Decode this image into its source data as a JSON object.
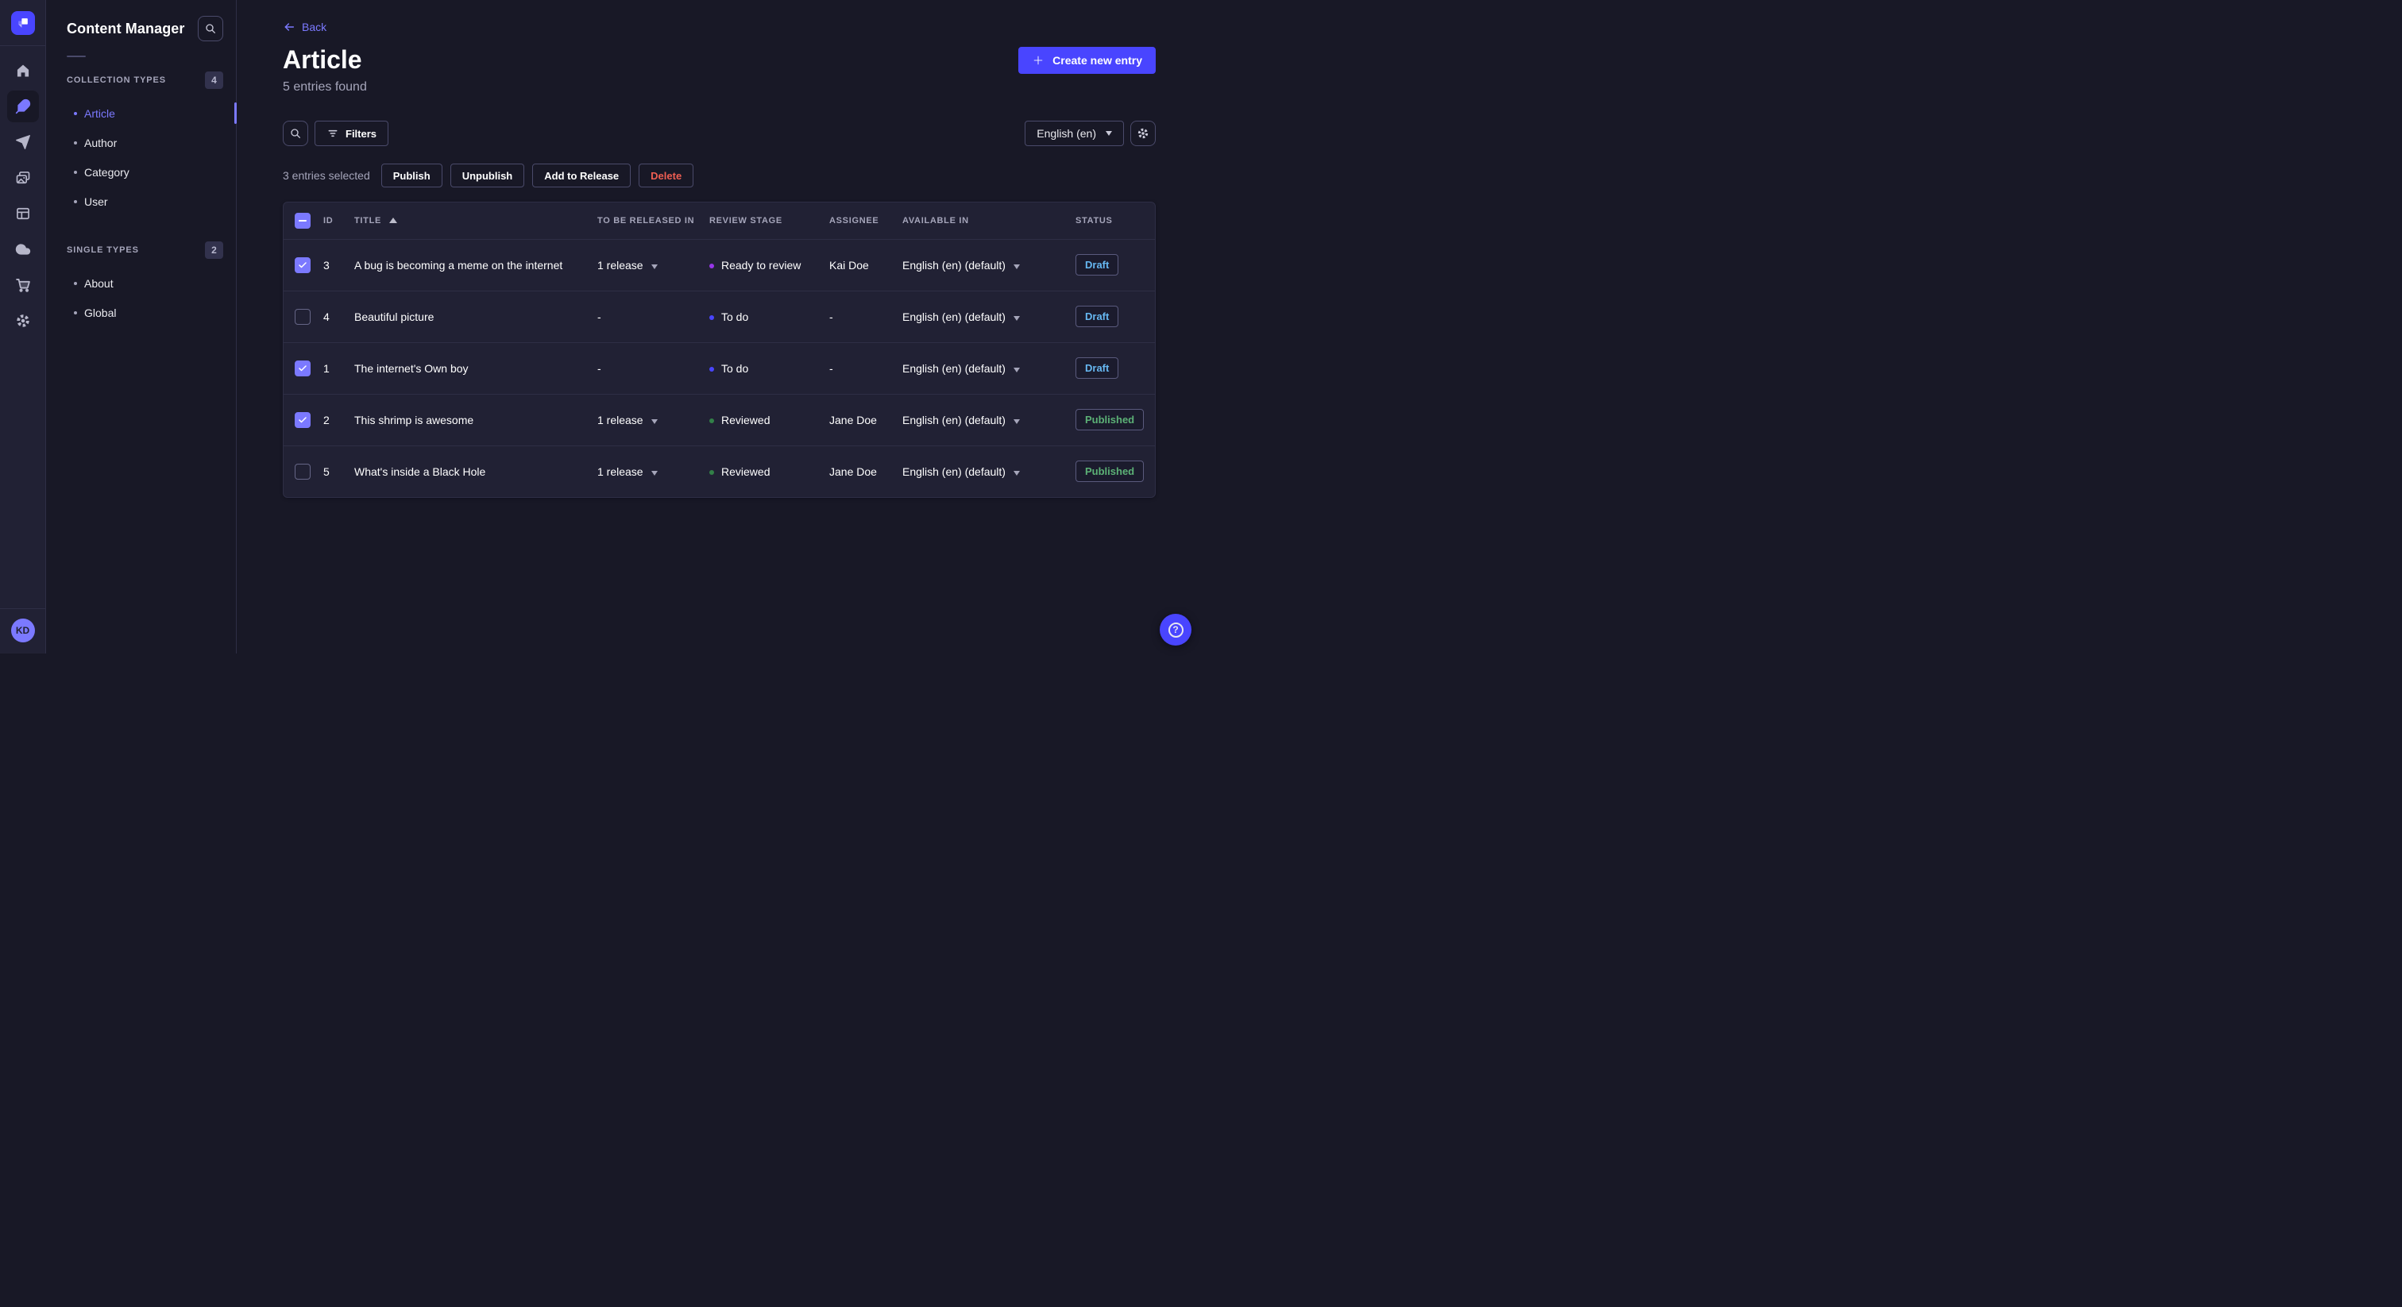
{
  "rail": {
    "logo_icon": "strapi-logo-icon",
    "items": [
      {
        "icon": "home-icon",
        "active": false
      },
      {
        "icon": "content-manager-feather-icon",
        "active": true
      },
      {
        "icon": "releases-paper-plane-icon",
        "active": false
      },
      {
        "icon": "media-library-images-icon",
        "active": false
      },
      {
        "icon": "content-type-builder-layout-icon",
        "active": false
      },
      {
        "icon": "deploy-cloud-icon",
        "active": false
      },
      {
        "icon": "marketplace-cart-icon",
        "active": false
      },
      {
        "icon": "settings-gear-icon",
        "active": false
      }
    ],
    "avatar_initials": "KD"
  },
  "subnav": {
    "title": "Content Manager",
    "search_icon": "search-icon",
    "sections": [
      {
        "label": "COLLECTION TYPES",
        "count": "4",
        "items": [
          {
            "label": "Article",
            "active": true
          },
          {
            "label": "Author",
            "active": false
          },
          {
            "label": "Category",
            "active": false
          },
          {
            "label": "User",
            "active": false
          }
        ]
      },
      {
        "label": "SINGLE TYPES",
        "count": "2",
        "items": [
          {
            "label": "About",
            "active": false
          },
          {
            "label": "Global",
            "active": false
          }
        ]
      }
    ]
  },
  "header": {
    "back_label": "Back",
    "title": "Article",
    "subtitle": "5 entries found",
    "create_button_label": "Create new entry"
  },
  "toolbar": {
    "filters_button_label": "Filters",
    "locale_selected": "English (en)"
  },
  "selection": {
    "summary": "3 entries selected",
    "publish_label": "Publish",
    "unpublish_label": "Unpublish",
    "add_to_release_label": "Add to Release",
    "delete_label": "Delete"
  },
  "table": {
    "header_checkbox_state": "indeterminate",
    "sort_column": "TITLE",
    "sort_direction": "asc",
    "columns": [
      "ID",
      "TITLE",
      "TO BE RELEASED IN",
      "REVIEW STAGE",
      "ASSIGNEE",
      "AVAILABLE IN",
      "STATUS"
    ],
    "rows": [
      {
        "checked": true,
        "id": "3",
        "title": "A bug is becoming a meme on the internet",
        "release": "1 release",
        "release_dropdown": true,
        "stage": "Ready to review",
        "stage_color": "#9736e8",
        "assignee": "Kai Doe",
        "available_in": "English (en) (default)",
        "status": "Draft"
      },
      {
        "checked": false,
        "id": "4",
        "title": "Beautiful picture",
        "release": "-",
        "release_dropdown": false,
        "stage": "To do",
        "stage_color": "#4945ff",
        "assignee": "-",
        "available_in": "English (en) (default)",
        "status": "Draft"
      },
      {
        "checked": true,
        "id": "1",
        "title": "The internet's Own boy",
        "release": "-",
        "release_dropdown": false,
        "stage": "To do",
        "stage_color": "#4945ff",
        "assignee": "-",
        "available_in": "English (en) (default)",
        "status": "Draft"
      },
      {
        "checked": true,
        "id": "2",
        "title": "This shrimp is awesome",
        "release": "1 release",
        "release_dropdown": true,
        "stage": "Reviewed",
        "stage_color": "#328048",
        "assignee": "Jane Doe",
        "available_in": "English (en) (default)",
        "status": "Published"
      },
      {
        "checked": false,
        "id": "5",
        "title": "What's inside a Black Hole",
        "release": "1 release",
        "release_dropdown": true,
        "stage": "Reviewed",
        "stage_color": "#328048",
        "assignee": "Jane Doe",
        "available_in": "English (en) (default)",
        "status": "Published"
      }
    ],
    "status_colors": {
      "Draft": "#66b7f1",
      "Published": "#5cb176"
    }
  },
  "colors": {
    "primary": "#4945ff",
    "primary_light": "#7b79ff",
    "background": "#181826",
    "surface": "#212134",
    "border": "#2e2e45",
    "text_muted": "#a5a5ba",
    "danger": "#ee5e52",
    "success": "#5cb176",
    "draft_blue": "#66b7f1"
  }
}
